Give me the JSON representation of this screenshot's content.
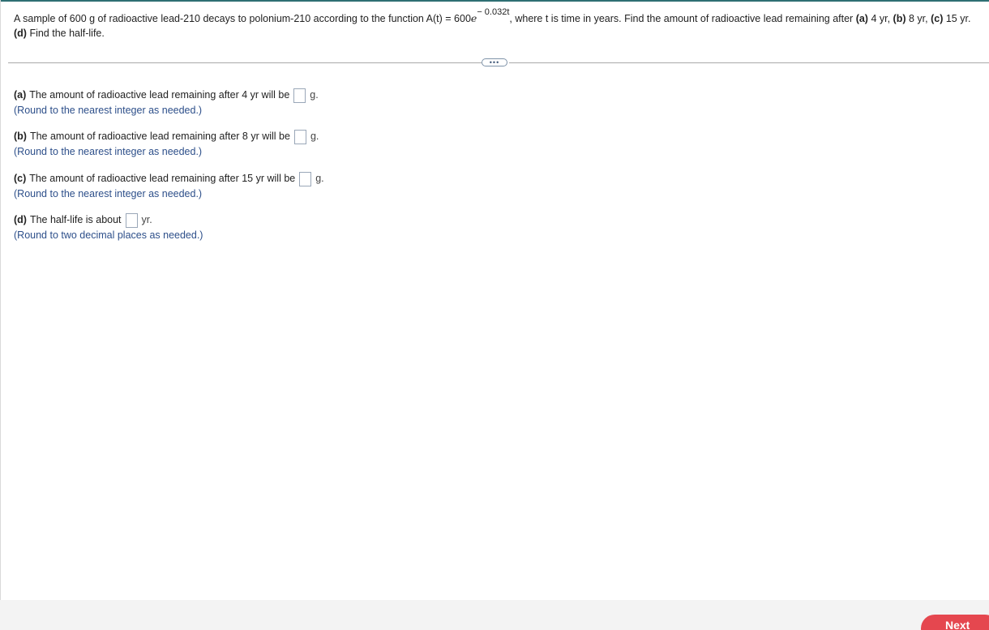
{
  "question": {
    "intro": "A sample of 600 g of radioactive lead-210 decays to polonium-210 according to the function A(t) = 600",
    "e_symbol": "e",
    "exponent": "− 0.032t",
    "after_function": ", where t is time in years. Find the amount of radioactive lead remaining after ",
    "a_label": "(a)",
    "a_value": " 4 yr, ",
    "b_label": "(b)",
    "b_value": " 8 yr, ",
    "c_label": "(c)",
    "c_value": " 15 yr. ",
    "d_label": "(d)",
    "d_value": " Find the half-life."
  },
  "more_button": "•••",
  "parts": [
    {
      "label": "(a)",
      "text": "The amount of radioactive lead remaining after 4 yr will be",
      "unit": "g.",
      "answer": "",
      "hint": "(Round to the nearest integer as needed.)"
    },
    {
      "label": "(b)",
      "text": "The amount of radioactive lead remaining after 8 yr will be",
      "unit": "g.",
      "answer": "",
      "hint": "(Round to the nearest integer as needed.)"
    },
    {
      "label": "(c)",
      "text": "The amount of radioactive lead remaining after 15 yr will be",
      "unit": "g.",
      "answer": "",
      "hint": "(Round to the nearest integer as needed.)"
    },
    {
      "label": "(d)",
      "text": "The half-life is about",
      "unit": "yr.",
      "answer": "",
      "hint": "(Round to two decimal places as needed.)"
    }
  ],
  "footer": {
    "next_label": "Next"
  },
  "colors": {
    "accent_top": "#2e6f73",
    "hint_text": "#2d4f8a",
    "next_button": "#e5474f"
  }
}
